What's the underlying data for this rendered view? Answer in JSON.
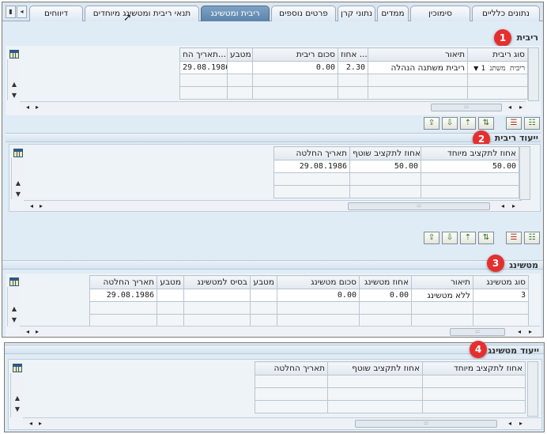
{
  "tabs": [
    {
      "label": "נתונים כלליים"
    },
    {
      "label": "סימוכין"
    },
    {
      "label": "ממדים"
    },
    {
      "label": "נתוני קרן"
    },
    {
      "label": "פרטים נוספים"
    },
    {
      "label": "ריבית ומטשינג"
    },
    {
      "label": "תנאי ריבית ומטשינג מיוחדים"
    },
    {
      "label": "דיווחים"
    }
  ],
  "interest": {
    "title": "ריבית",
    "columns": [
      "סוג ריבית",
      "תיאור",
      "אחוז ...",
      "סכום ריבית",
      "מטבע",
      "תאריך הח..."
    ],
    "row": {
      "type": "1 ריבית משתנ",
      "desc": "ריבית משתנה הנהלה",
      "percent": "2.30",
      "amount": "0.00",
      "currency": "",
      "date": "29.08.1986"
    }
  },
  "interest_alloc": {
    "title": "ייעוד ריבית",
    "columns": [
      "אחוז לתקציב מיוחד",
      "אחוז לתקציב שוטף",
      "תאריך החלטה"
    ],
    "row": {
      "special": "50.00",
      "current": "50.00",
      "date": "29.08.1986"
    }
  },
  "matching": {
    "title": "מטשינג",
    "columns": [
      "סוג מטשינג",
      "תיאור",
      "אחוז מטשינג",
      "סכום מטשינג",
      "מטבע",
      "בסיס למטשינג",
      "מטבע",
      "תאריך החלטה"
    ],
    "row": {
      "type": "3",
      "desc": "ללא מטשינג",
      "percent": "0.00",
      "amount": "0.00",
      "currency": "",
      "base": "",
      "currency2": "",
      "date": "29.08.1986"
    }
  },
  "matching_alloc": {
    "title": "ייעוד מטשינג",
    "columns": [
      "אחוז לתקציב מיוחד",
      "אחוז לתקציב שוטף",
      "תאריך החלטה"
    ]
  },
  "badges": [
    "1",
    "2",
    "3",
    "4"
  ],
  "colors": {
    "active_tab": "#5b83ab",
    "badge": "#e52f2f",
    "frame_bg": "#dfebf5"
  }
}
